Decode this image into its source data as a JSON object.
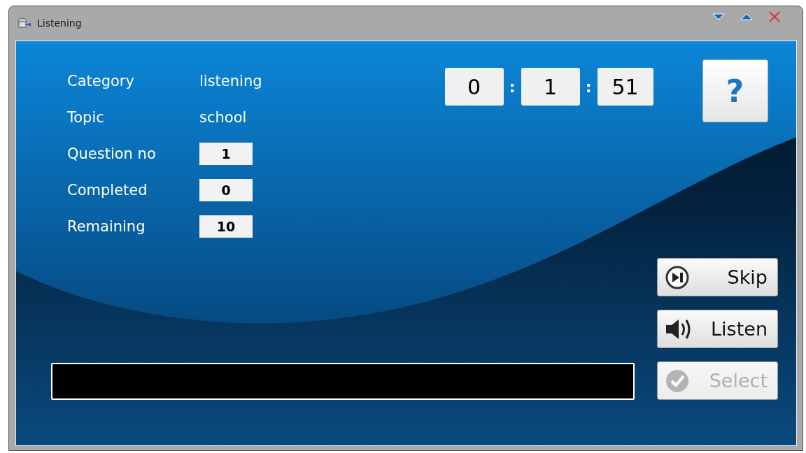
{
  "window": {
    "title": "Listening"
  },
  "info": [
    {
      "label": "Category",
      "value": "listening",
      "kind": "text"
    },
    {
      "label": "Topic",
      "value": "school",
      "kind": "text"
    },
    {
      "label": "Question no",
      "value": "1",
      "kind": "box"
    },
    {
      "label": "Completed",
      "value": "0",
      "kind": "box"
    },
    {
      "label": "Remaining",
      "value": "10",
      "kind": "box"
    }
  ],
  "timer": {
    "hours": "0",
    "minutes": "1",
    "seconds": "51",
    "separator": ":"
  },
  "help_button": "?",
  "answer_field": {
    "disabled": false
  },
  "buttons": [
    {
      "label": "Skip",
      "kind": "skip",
      "disabled": false
    },
    {
      "label": "Listen",
      "kind": "listen",
      "disabled": false
    },
    {
      "label": "Select",
      "kind": "select",
      "disabled": true
    }
  ]
}
